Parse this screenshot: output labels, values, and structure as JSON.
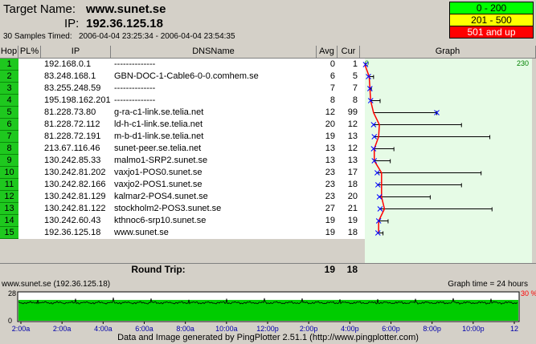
{
  "header": {
    "target_label": "Target Name:",
    "target_value": "www.sunet.se",
    "ip_label": "IP:",
    "ip_value": "192.36.125.18",
    "samples_label": "30 Samples Timed:",
    "time_range": "2006-04-04 23:25:34 - 2006-04-04 23:54:35"
  },
  "legend": [
    {
      "label": "0 - 200",
      "color": "#00ff00"
    },
    {
      "label": "201 - 500",
      "color": "#ffff00"
    },
    {
      "label": "501 and up",
      "color": "#ff0000"
    }
  ],
  "columns": {
    "hop": "Hop",
    "pl": "PL%",
    "ip": "IP",
    "dns": "DNSName",
    "avg": "Avg",
    "cur": "Cur",
    "graph": "Graph"
  },
  "graph_scale": {
    "min_label": "0",
    "max_label": "230",
    "max": 230
  },
  "hops": [
    {
      "hop": "1",
      "pl": "",
      "ip": "192.168.0.1",
      "dns": "--------------",
      "avg": "0",
      "cur": "1",
      "avg_ms": 0,
      "cur_ms": 1,
      "max_ms": 1
    },
    {
      "hop": "2",
      "pl": "",
      "ip": "83.248.168.1",
      "dns": "GBN-DOC-1-Cable6-0-0.comhem.se",
      "avg": "6",
      "cur": "5",
      "avg_ms": 6,
      "cur_ms": 5,
      "max_ms": 12
    },
    {
      "hop": "3",
      "pl": "",
      "ip": "83.255.248.59",
      "dns": "--------------",
      "avg": "7",
      "cur": "7",
      "avg_ms": 7,
      "cur_ms": 7,
      "max_ms": 9
    },
    {
      "hop": "4",
      "pl": "",
      "ip": "195.198.162.201",
      "dns": "--------------",
      "avg": "8",
      "cur": "8",
      "avg_ms": 8,
      "cur_ms": 8,
      "max_ms": 21
    },
    {
      "hop": "5",
      "pl": "",
      "ip": "81.228.73.80",
      "dns": "g-ra-c1-link.se.telia.net",
      "avg": "12",
      "cur": "99",
      "avg_ms": 12,
      "cur_ms": 99,
      "max_ms": 99
    },
    {
      "hop": "6",
      "pl": "",
      "ip": "81.228.72.112",
      "dns": "ld-h-c1-link.se.telia.net",
      "avg": "20",
      "cur": "12",
      "avg_ms": 20,
      "cur_ms": 12,
      "max_ms": 133
    },
    {
      "hop": "7",
      "pl": "",
      "ip": "81.228.72.191",
      "dns": "m-b-d1-link.se.telia.net",
      "avg": "19",
      "cur": "13",
      "avg_ms": 19,
      "cur_ms": 13,
      "max_ms": 172
    },
    {
      "hop": "8",
      "pl": "",
      "ip": "213.67.116.46",
      "dns": "sunet-peer.se.telia.net",
      "avg": "13",
      "cur": "12",
      "avg_ms": 13,
      "cur_ms": 12,
      "max_ms": 40
    },
    {
      "hop": "9",
      "pl": "",
      "ip": "130.242.85.33",
      "dns": "malmo1-SRP2.sunet.se",
      "avg": "13",
      "cur": "13",
      "avg_ms": 13,
      "cur_ms": 13,
      "max_ms": 35
    },
    {
      "hop": "10",
      "pl": "",
      "ip": "130.242.81.202",
      "dns": "vaxjo1-POS0.sunet.se",
      "avg": "23",
      "cur": "17",
      "avg_ms": 23,
      "cur_ms": 17,
      "max_ms": 160
    },
    {
      "hop": "11",
      "pl": "",
      "ip": "130.242.82.166",
      "dns": "vaxjo2-POS1.sunet.se",
      "avg": "23",
      "cur": "18",
      "avg_ms": 23,
      "cur_ms": 18,
      "max_ms": 133
    },
    {
      "hop": "12",
      "pl": "",
      "ip": "130.242.81.129",
      "dns": "kalmar2-POS4.sunet.se",
      "avg": "23",
      "cur": "20",
      "avg_ms": 23,
      "cur_ms": 20,
      "max_ms": 90
    },
    {
      "hop": "13",
      "pl": "",
      "ip": "130.242.81.122",
      "dns": "stockholm2-POS3.sunet.se",
      "avg": "27",
      "cur": "21",
      "avg_ms": 27,
      "cur_ms": 21,
      "max_ms": 175
    },
    {
      "hop": "14",
      "pl": "",
      "ip": "130.242.60.43",
      "dns": "kthnoc6-srp10.sunet.se",
      "avg": "19",
      "cur": "19",
      "avg_ms": 19,
      "cur_ms": 19,
      "max_ms": 32
    },
    {
      "hop": "15",
      "pl": "",
      "ip": "192.36.125.18",
      "dns": "www.sunet.se",
      "avg": "19",
      "cur": "18",
      "avg_ms": 19,
      "cur_ms": 18,
      "max_ms": 25
    }
  ],
  "round_trip": {
    "label": "Round Trip:",
    "avg": "19",
    "cur": "18"
  },
  "timeline": {
    "title": "www.sunet.se (192.36.125.18)",
    "graph_time": "Graph time = 24 hours",
    "y_max": "28",
    "y_min": "0",
    "loss_label": "30 %",
    "x_labels": [
      "2:00a",
      "2:00a",
      "4:00a",
      "6:00a",
      "8:00a",
      "10:00a",
      "12:00p",
      "2:00p",
      "4:00p",
      "6:00p",
      "8:00p",
      "10:00p",
      "12"
    ]
  },
  "footer": "Data and Image generated by PingPlotter 2.51.1 (http://www.pingplotter.com)",
  "colors": {
    "hop_green": "#1ec81e",
    "graph_bg": "#e6fbe6",
    "line_red": "#ff0000",
    "marker_blue": "#0000ff",
    "timeline_green": "#00cc00"
  }
}
